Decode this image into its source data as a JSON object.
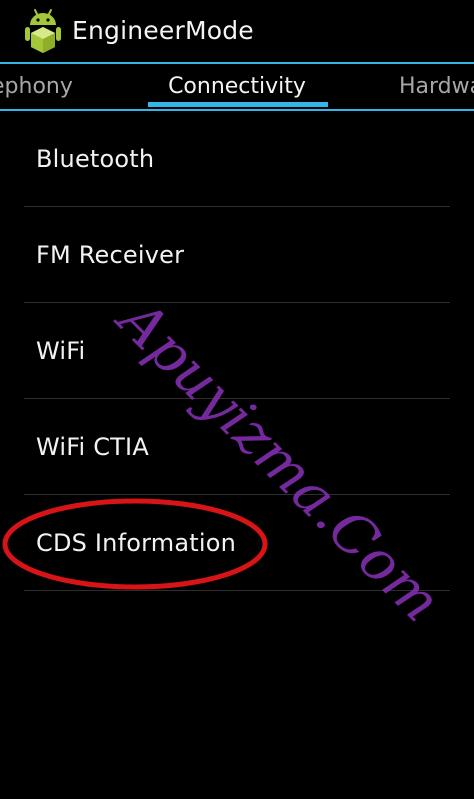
{
  "action_bar": {
    "title": "EngineerMode",
    "icon": "android-robot-icon"
  },
  "tabs": [
    {
      "label": "ephony",
      "selected": false
    },
    {
      "label": "Connectivity",
      "selected": true
    },
    {
      "label": "Hardwa",
      "selected": false
    }
  ],
  "list": {
    "items": [
      {
        "label": "Bluetooth"
      },
      {
        "label": "FM Receiver"
      },
      {
        "label": "WiFi"
      },
      {
        "label": "WiFi CTIA"
      },
      {
        "label": "CDS Information",
        "circled": true
      }
    ]
  },
  "watermark": {
    "text": "Apuyizma.Com"
  },
  "colors": {
    "accent": "#33b5e5",
    "background": "#000000",
    "text": "#f2f2f2",
    "tab_inactive": "#a7a7a7",
    "annotation_red": "#d81416",
    "watermark": "#7b2ca6",
    "android_green": "#a4c639"
  }
}
